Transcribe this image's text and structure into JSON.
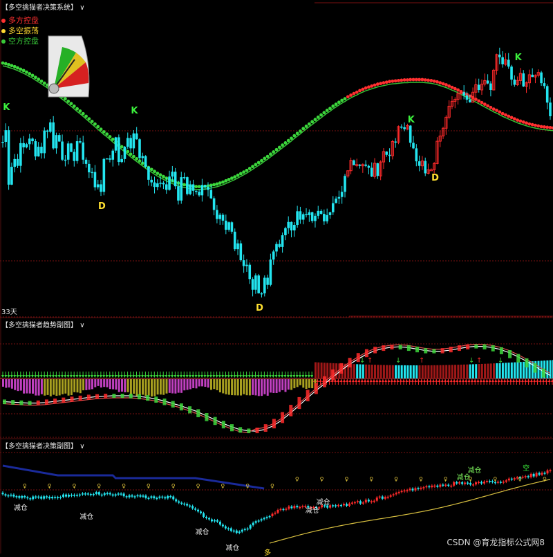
{
  "colors": {
    "up": "#ff2a2a",
    "down": "#23e5f0",
    "ma_green": "#3cd73c",
    "ma_red": "#ff3030",
    "yellow": "#ffe030",
    "magenta": "#c040c0",
    "olive": "#a8a020",
    "navy": "#1a2a9a",
    "grid": "#7a1010"
  },
  "panel_main": {
    "title": "【多空擒猫者决策系统】",
    "title_arrow": "∨",
    "legend": [
      {
        "label": "多方控盘",
        "color": "#ff3030"
      },
      {
        "label": "多空振荡",
        "color": "#ffd830"
      },
      {
        "label": "空方控盘",
        "color": "#38c838"
      }
    ],
    "days_label": "33天",
    "signals": [
      {
        "text": "K",
        "color": "#3cf03c",
        "i": 1,
        "side": "above"
      },
      {
        "text": "D",
        "color": "#ffe030",
        "i": 33,
        "side": "below"
      },
      {
        "text": "K",
        "color": "#3cf03c",
        "i": 44,
        "side": "above"
      },
      {
        "text": "D",
        "color": "#ffe030",
        "i": 86,
        "side": "below"
      },
      {
        "text": "K",
        "color": "#3cf03c",
        "i": 137,
        "side": "above"
      },
      {
        "text": "D",
        "color": "#ffe030",
        "i": 145,
        "side": "below"
      },
      {
        "text": "K",
        "color": "#3cf03c",
        "i": 173,
        "side": "above"
      }
    ]
  },
  "panel_osc": {
    "title": "【多空擒猫者趋势副图】",
    "title_arrow": "∨"
  },
  "panel_bottom": {
    "title": "【多空擒猫者决策副图】",
    "title_arrow": "∨",
    "labels": [
      {
        "text": "减仓",
        "i": 6
      },
      {
        "text": "减仓",
        "i": 30
      },
      {
        "text": "减仓",
        "i": 72
      },
      {
        "text": "减仓",
        "i": 83
      },
      {
        "text": "减仓",
        "i": 112
      },
      {
        "text": "减仓",
        "i": 116
      },
      {
        "text": "减仓",
        "i": 167
      },
      {
        "text": "减仓",
        "i": 171
      },
      {
        "text": "空",
        "i": 191
      },
      {
        "text": "多",
        "i": 97
      }
    ]
  },
  "watermark": "CSDN @育龙指标公式网8",
  "chart_data": [
    {
      "type": "candlestick",
      "title": "【多空擒猫者决策系统】",
      "close": [
        121.2,
        124.8,
        108.0,
        113.5,
        115.9,
        113.8,
        120.8,
        119.5,
        120.5,
        122.2,
        121.4,
        116.7,
        119.7,
        117.7,
        124.7,
        124.3,
        127.2,
        119.2,
        123.3,
        121.3,
        115.7,
        115.7,
        120.7,
        118.1,
        115.3,
        121.4,
        121.0,
        115.7,
        114.4,
        111.8,
        111.9,
        107.2,
        108.1,
        105.8,
        115.9,
        116.1,
        115.7,
        118.5,
        122.6,
        115.0,
        115.9,
        119.7,
        122.4,
        119.2,
        123.8,
        122.0,
        116.2,
        116.8,
        113.5,
        109.5,
        108.7,
        107.3,
        108.4,
        108.6,
        108.1,
        106.4,
        110.5,
        112.0,
        107.5,
        103.1,
        110.3,
        110.3,
        105.1,
        108.1,
        106.1,
        105.8,
        104.7,
        107.9,
        107.3,
        106.4,
        103.8,
        100.2,
        97.4,
        98.7,
        96.9,
        94.1,
        96.4,
        93.5,
        88.1,
        89.9,
        84.7,
        82.9,
        83.3,
        78.9,
        75.6,
        80.0,
        74.5,
        74.5,
        79.3,
        77.1,
        84.9,
        87.4,
        89.7,
        88.8,
        92.4,
        94.6,
        96.5,
        93.9,
        95.6,
        99.8,
        97.2,
        98.9,
        98.6,
        99.5,
        96.8,
        98.4,
        99.9,
        99.0,
        96.7,
        98.6,
        99.5,
        102.3,
        103.7,
        104.2,
        105.8,
        110.7,
        112.3,
        115.5,
        114.0,
        114.2,
        113.8,
        114.2,
        113.8,
        113.2,
        110.5,
        114.6,
        110.7,
        115.0,
        118.2,
        117.2,
        116.9,
        121.3,
        121.1,
        125.9,
        125.7,
        125.1,
        126.2,
        120.9,
        119.2,
        115.2,
        113.8,
        115.3,
        111.5,
        112.6,
        112.6,
        114.5,
        121.4,
        123.0,
        125.4,
        128.8,
        132.2,
        133.7,
        134.3,
        136.1,
        136.5,
        135.5,
        134.2,
        133.4,
        136.5,
        138.8,
        137.2,
        139.0,
        140.1,
        139.2,
        137.2,
        143.3,
        148.1,
        147.3,
        145.1,
        146.5,
        144.4,
        140.4,
        138.8,
        140.1,
        142.3,
        138.3,
        139.4,
        141.9,
        141.2,
        141.7,
        142.6,
        139.3,
        138.4,
        133.3,
        129.1
      ],
      "ma_slow": [
        145.5,
        145.3,
        145.0,
        144.7,
        144.4,
        144.0,
        143.6,
        143.2,
        142.7,
        142.2,
        141.7,
        141.1,
        140.5,
        139.9,
        139.3,
        138.7,
        138.0,
        137.3,
        136.6,
        135.9,
        135.2,
        134.5,
        133.7,
        133.0,
        132.2,
        131.4,
        130.7,
        129.9,
        129.1,
        128.3,
        127.5,
        126.7,
        125.9,
        125.1,
        124.3,
        123.6,
        122.8,
        122.0,
        121.2,
        120.4,
        119.7,
        118.9,
        118.2,
        117.4,
        116.7,
        116.0,
        115.3,
        114.6,
        113.9,
        113.3,
        112.7,
        112.1,
        111.5,
        111.0,
        110.5,
        110.0,
        109.6,
        109.2,
        108.8,
        108.5,
        108.2,
        108.0,
        107.8,
        107.6,
        107.5,
        107.4,
        107.4,
        107.4,
        107.5,
        107.6,
        107.8,
        108.0,
        108.2,
        108.5,
        108.8,
        109.2,
        109.6,
        110.0,
        110.4,
        110.9,
        111.4,
        111.9,
        112.4,
        113.0,
        113.6,
        114.2,
        114.8,
        115.4,
        116.1,
        116.7,
        117.4,
        118.1,
        118.8,
        119.5,
        120.2,
        120.9,
        121.6,
        122.3,
        123.1,
        123.8,
        124.5,
        125.3,
        126.0,
        126.7,
        127.4,
        128.1,
        128.8,
        129.5,
        130.2,
        130.9,
        131.5,
        132.2,
        132.8,
        133.4,
        134.0,
        134.5,
        135.1,
        135.6,
        136.1,
        136.5,
        137.0,
        137.4,
        137.8,
        138.1,
        138.4,
        138.7,
        139.0,
        139.2,
        139.4,
        139.6,
        139.8,
        139.9,
        140.0,
        140.1,
        140.2,
        140.3,
        140.3,
        140.4,
        140.4,
        140.4,
        140.4,
        140.4,
        140.3,
        140.2,
        140.1,
        139.9,
        139.7,
        139.4,
        139.1,
        138.8,
        138.4,
        138.0,
        137.6,
        137.2,
        136.7,
        136.2,
        135.8,
        135.3,
        134.8,
        134.3,
        133.8,
        133.3,
        132.8,
        132.3,
        131.8,
        131.3,
        130.9,
        130.4,
        129.9,
        129.5,
        129.1,
        128.7,
        128.3,
        127.9,
        127.6,
        127.3,
        127.0,
        126.7,
        126.5,
        126.3,
        126.1,
        125.9,
        125.8,
        125.7,
        125.6,
        125.5
      ]
    },
    {
      "type": "bar+line",
      "title": "【多空擒猫者趋势副图】",
      "series": [
        {
          "values": [
            -0.22,
            -0.23,
            -0.24,
            -0.25,
            -0.25,
            -0.24,
            -0.22,
            -0.2,
            -0.18,
            -0.16,
            -0.14,
            -0.12,
            -0.11,
            -0.1,
            -0.1,
            -0.1,
            -0.11,
            -0.13,
            -0.16,
            -0.2,
            -0.25,
            -0.3,
            -0.36,
            -0.42,
            -0.5,
            -0.58,
            -0.66,
            -0.73,
            -0.79,
            -0.82,
            -0.83,
            -0.8,
            -0.73,
            -0.62,
            -0.48,
            -0.33,
            -0.17,
            -0.02,
            0.12,
            0.26,
            0.4,
            0.53,
            0.64,
            0.74,
            0.82,
            0.87,
            0.9,
            0.91,
            0.9,
            0.87,
            0.84,
            0.82,
            0.82,
            0.84,
            0.87,
            0.9,
            0.92,
            0.92,
            0.9,
            0.86,
            0.8,
            0.72,
            0.63,
            0.53,
            0.42,
            0.32
          ]
        }
      ]
    },
    {
      "type": "candlestick+line",
      "title": "【多空擒猫者决策副图】"
    }
  ]
}
